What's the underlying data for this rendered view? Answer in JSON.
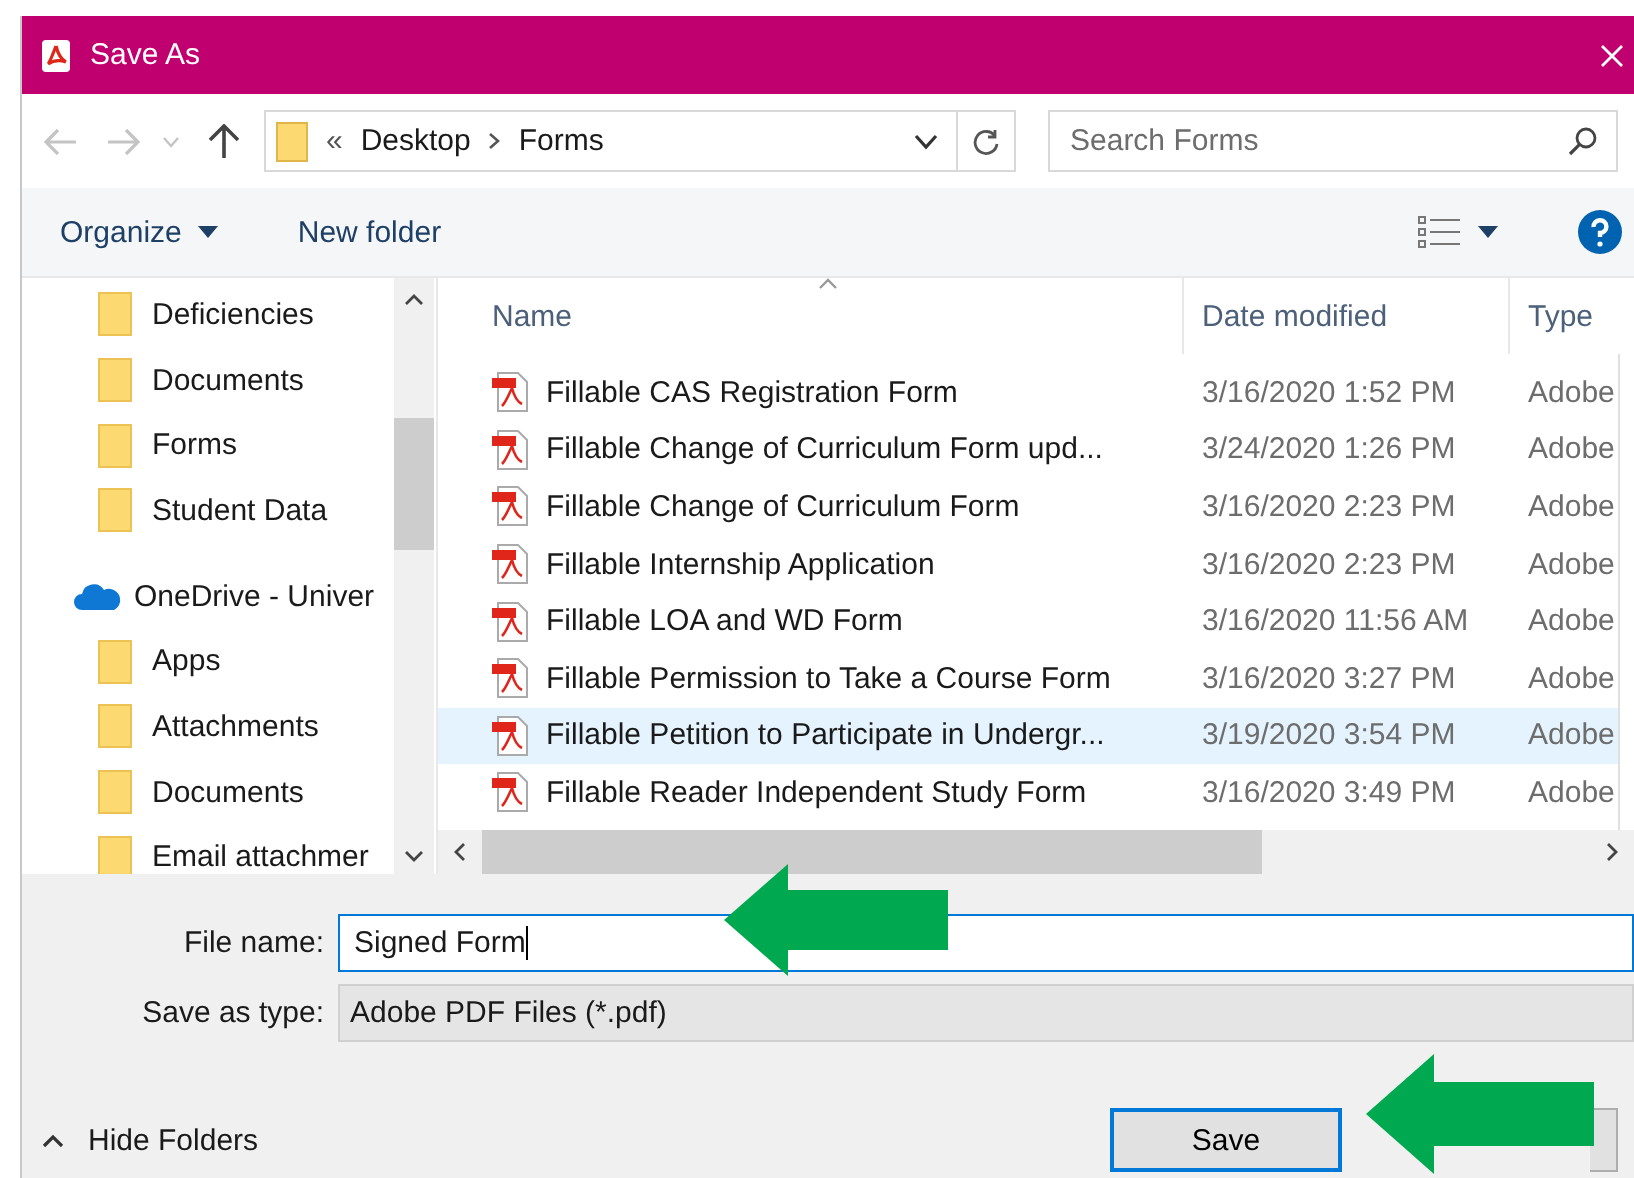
{
  "window": {
    "title": "Save As"
  },
  "address_bar": {
    "overflow": "«",
    "path": [
      "Desktop",
      "Forms"
    ]
  },
  "search": {
    "placeholder": "Search Forms"
  },
  "toolbar": {
    "items": [
      {
        "label": "Organize",
        "dropdown": true
      },
      {
        "label": "New folder",
        "dropdown": false
      }
    ]
  },
  "sidebar": {
    "items": [
      {
        "kind": "folder",
        "label": "Deficiencies"
      },
      {
        "kind": "folder",
        "label": "Documents"
      },
      {
        "kind": "folder",
        "label": "Forms"
      },
      {
        "kind": "folder",
        "label": "Student Data"
      },
      {
        "kind": "cloud",
        "label": "OneDrive - Univer"
      },
      {
        "kind": "folder",
        "label": "Apps"
      },
      {
        "kind": "folder",
        "label": "Attachments"
      },
      {
        "kind": "folder",
        "label": "Documents"
      },
      {
        "kind": "folder",
        "label": "Email attachmer"
      }
    ]
  },
  "table": {
    "columns": [
      "Name",
      "Date modified",
      "Type"
    ],
    "rows": [
      {
        "name": "Fillable CAS Registration Form",
        "date": "3/16/2020 1:52 PM",
        "type": "Adobe",
        "selected": false
      },
      {
        "name": "Fillable Change of Curriculum Form upd...",
        "date": "3/24/2020 1:26 PM",
        "type": "Adobe",
        "selected": false
      },
      {
        "name": "Fillable Change of Curriculum Form",
        "date": "3/16/2020 2:23 PM",
        "type": "Adobe",
        "selected": false
      },
      {
        "name": "Fillable Internship Application",
        "date": "3/16/2020 2:23 PM",
        "type": "Adobe",
        "selected": false
      },
      {
        "name": "Fillable LOA and WD Form",
        "date": "3/16/2020 11:56 AM",
        "type": "Adobe",
        "selected": false
      },
      {
        "name": "Fillable Permission to Take a Course Form",
        "date": "3/16/2020 3:27 PM",
        "type": "Adobe",
        "selected": false
      },
      {
        "name": "Fillable Petition to Participate in Undergr...",
        "date": "3/19/2020 3:54 PM",
        "type": "Adobe",
        "selected": true
      },
      {
        "name": "Fillable Reader Independent Study Form",
        "date": "3/16/2020 3:49 PM",
        "type": "Adobe",
        "selected": false
      }
    ]
  },
  "file_name": {
    "label": "File name:",
    "value": "Signed Form"
  },
  "save_as_type": {
    "label": "Save as type:",
    "value": "Adobe PDF Files (*.pdf)"
  },
  "hide_folders": "Hide Folders",
  "buttons": [
    "Save"
  ]
}
